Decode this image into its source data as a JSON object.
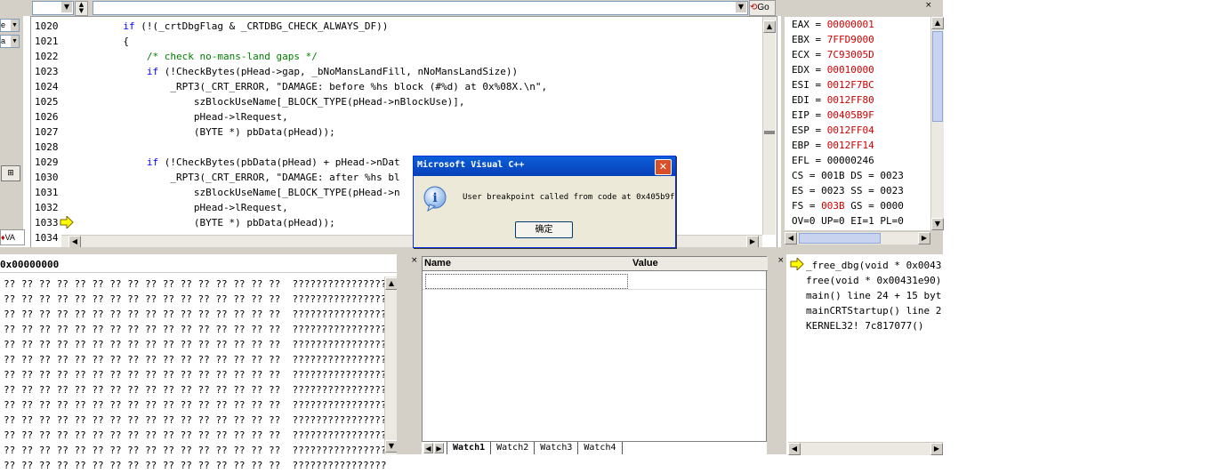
{
  "toolbar": {
    "combo2_value": "",
    "go_label": "Go"
  },
  "left_strip": {
    "combo_a": "e",
    "combo_b": "a",
    "va_label": "VA"
  },
  "source": {
    "lines": [
      {
        "num": "1020",
        "segments": [
          {
            "t": "        ",
            "c": ""
          },
          {
            "t": "if",
            "c": "kw"
          },
          {
            "t": " (!(_crtDbgFlag & _CRTDBG_CHECK_ALWAYS_DF))",
            "c": ""
          }
        ]
      },
      {
        "num": "1021",
        "segments": [
          {
            "t": "        {",
            "c": ""
          }
        ]
      },
      {
        "num": "1022",
        "segments": [
          {
            "t": "            ",
            "c": ""
          },
          {
            "t": "/* check no-mans-land gaps */",
            "c": "cm"
          }
        ]
      },
      {
        "num": "1023",
        "segments": [
          {
            "t": "            ",
            "c": ""
          },
          {
            "t": "if",
            "c": "kw"
          },
          {
            "t": " (!CheckBytes(pHead->gap, _bNoMansLandFill, nNoMansLandSize))",
            "c": ""
          }
        ]
      },
      {
        "num": "1024",
        "segments": [
          {
            "t": "                _RPT3(_CRT_ERROR, \"DAMAGE: before %hs block (#%d) at 0x%08X.\\n\",",
            "c": ""
          }
        ]
      },
      {
        "num": "1025",
        "segments": [
          {
            "t": "                    szBlockUseName[_BLOCK_TYPE(pHead->nBlockUse)],",
            "c": ""
          }
        ]
      },
      {
        "num": "1026",
        "segments": [
          {
            "t": "                    pHead->lRequest,",
            "c": ""
          }
        ]
      },
      {
        "num": "1027",
        "segments": [
          {
            "t": "                    (BYTE *) pbData(pHead));",
            "c": ""
          }
        ]
      },
      {
        "num": "1028",
        "segments": [
          {
            "t": "",
            "c": ""
          }
        ]
      },
      {
        "num": "1029",
        "segments": [
          {
            "t": "            ",
            "c": ""
          },
          {
            "t": "if",
            "c": "kw"
          },
          {
            "t": " (!CheckBytes(pbData(pHead) + pHead->nDat",
            "c": ""
          }
        ]
      },
      {
        "num": "1030",
        "segments": [
          {
            "t": "                _RPT3(_CRT_ERROR, \"DAMAGE: after %hs bl",
            "c": ""
          }
        ]
      },
      {
        "num": "1031",
        "segments": [
          {
            "t": "                    szBlockUseName[_BLOCK_TYPE(pHead->n",
            "c": ""
          }
        ]
      },
      {
        "num": "1032",
        "segments": [
          {
            "t": "                    pHead->lRequest,",
            "c": ""
          }
        ]
      },
      {
        "num": "1033",
        "segments": [
          {
            "t": "                    (BYTE *) pbData(pHead));",
            "c": ""
          }
        ]
      },
      {
        "num": "1034",
        "segments": [
          {
            "t": "",
            "c": ""
          }
        ]
      }
    ]
  },
  "registers": {
    "lines": [
      {
        "name": "EAX = ",
        "value": "00000001",
        "red": true
      },
      {
        "name": "EBX = ",
        "value": "7FFD9000",
        "red": true
      },
      {
        "name": "ECX = ",
        "value": "7C93005D",
        "red": true
      },
      {
        "name": "EDX = ",
        "value": "00010000",
        "red": true
      },
      {
        "name": "ESI = ",
        "value": "0012F7BC",
        "red": true
      },
      {
        "name": "EDI = ",
        "value": "0012FF80",
        "red": true
      },
      {
        "name": "EIP = ",
        "value": "00405B9F",
        "red": true
      },
      {
        "name": "ESP = ",
        "value": "0012FF04",
        "red": true
      },
      {
        "name": "EBP = ",
        "value": "0012FF14",
        "red": true
      },
      {
        "name": "EFL = ",
        "value": "00000246",
        "red": false
      },
      {
        "name": "CS = 001B DS = 0023",
        "value": "",
        "red": false
      },
      {
        "name": "ES = 0023 SS = 0023",
        "value": "",
        "red": false
      },
      {
        "name": "FS = ",
        "value": "003B",
        "tail": " GS = 0000",
        "red": true
      },
      {
        "name": "OV=0 UP=0 EI=1 PL=0",
        "value": "",
        "red": false
      }
    ]
  },
  "memory": {
    "address": "0x00000000",
    "rows": [
      "?? ?? ?? ?? ?? ?? ?? ?? ?? ?? ?? ?? ?? ?? ?? ??  ????????????????",
      "?? ?? ?? ?? ?? ?? ?? ?? ?? ?? ?? ?? ?? ?? ?? ??  ????????????????",
      "?? ?? ?? ?? ?? ?? ?? ?? ?? ?? ?? ?? ?? ?? ?? ??  ????????????????",
      "?? ?? ?? ?? ?? ?? ?? ?? ?? ?? ?? ?? ?? ?? ?? ??  ????????????????",
      "?? ?? ?? ?? ?? ?? ?? ?? ?? ?? ?? ?? ?? ?? ?? ??  ????????????????",
      "?? ?? ?? ?? ?? ?? ?? ?? ?? ?? ?? ?? ?? ?? ?? ??  ????????????????",
      "?? ?? ?? ?? ?? ?? ?? ?? ?? ?? ?? ?? ?? ?? ?? ??  ????????????????",
      "?? ?? ?? ?? ?? ?? ?? ?? ?? ?? ?? ?? ?? ?? ?? ??  ????????????????",
      "?? ?? ?? ?? ?? ?? ?? ?? ?? ?? ?? ?? ?? ?? ?? ??  ????????????????",
      "?? ?? ?? ?? ?? ?? ?? ?? ?? ?? ?? ?? ?? ?? ?? ??  ????????????????",
      "?? ?? ?? ?? ?? ?? ?? ?? ?? ?? ?? ?? ?? ?? ?? ??  ????????????????",
      "?? ?? ?? ?? ?? ?? ?? ?? ?? ?? ?? ?? ?? ?? ?? ??  ????????????????",
      "?? ?? ?? ?? ?? ?? ?? ?? ?? ?? ?? ?? ?? ?? ?? ??  ????????????????"
    ]
  },
  "watch": {
    "col_name": "Name",
    "col_value": "Value",
    "tabs": [
      "Watch1",
      "Watch2",
      "Watch3",
      "Watch4"
    ]
  },
  "callstack": {
    "lines": [
      "_free_dbg(void * 0x0043",
      "free(void * 0x00431e90)",
      "main() line 24 + 15 byt",
      "mainCRTStartup() line 2",
      "KERNEL32! 7c817077()"
    ]
  },
  "dialog": {
    "title": "Microsoft Visual C++",
    "message": "User breakpoint called from code at 0x405b9f",
    "ok_label": "确定"
  }
}
